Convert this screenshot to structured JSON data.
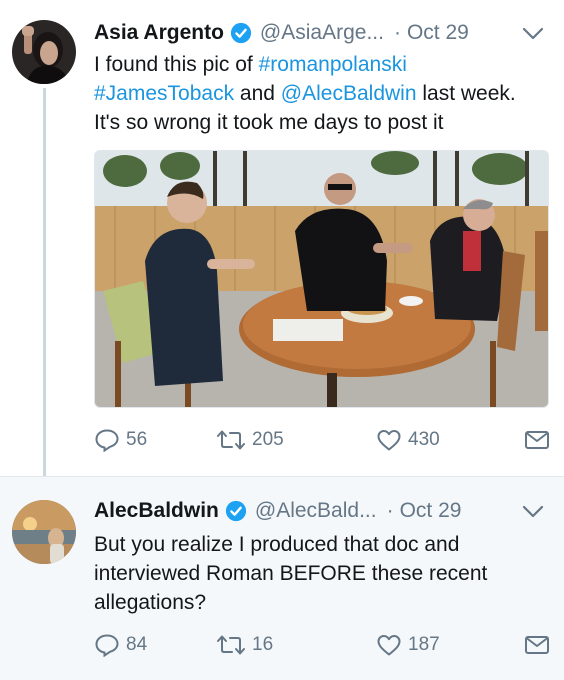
{
  "tweets": [
    {
      "display_name": "Asia Argento",
      "handle": "@AsiaArge...",
      "separator": "·",
      "date": "Oct 29",
      "text_part1": "I found this pic of ",
      "hashtag1": "#romanpolanski",
      "hashtag2": "#JamesToback",
      "text_part2": " and ",
      "mention": "@AlecBaldwin",
      "text_part3": " last week.",
      "text_line3": "It's so wrong it took me days to post it",
      "replies": "56",
      "retweets": "205",
      "likes": "430",
      "avatar_icon": "profile-photo-icon",
      "media_icon": "photo-icon"
    },
    {
      "display_name": "AlecBaldwin",
      "handle": "@AlecBald...",
      "separator": "·",
      "date": "Oct 29",
      "text_line1": "But you realize I produced that doc and",
      "text_line2": "interviewed Roman BEFORE these recent",
      "text_line3": "allegations?",
      "replies": "84",
      "retweets": "16",
      "likes": "187",
      "avatar_icon": "profile-photo-icon"
    }
  ],
  "colors": {
    "link": "#1b95e0",
    "verified": "#1da1f2",
    "muted": "#657786",
    "thread_line": "#ccd6dd",
    "reply_background": "#f5f8fa"
  }
}
